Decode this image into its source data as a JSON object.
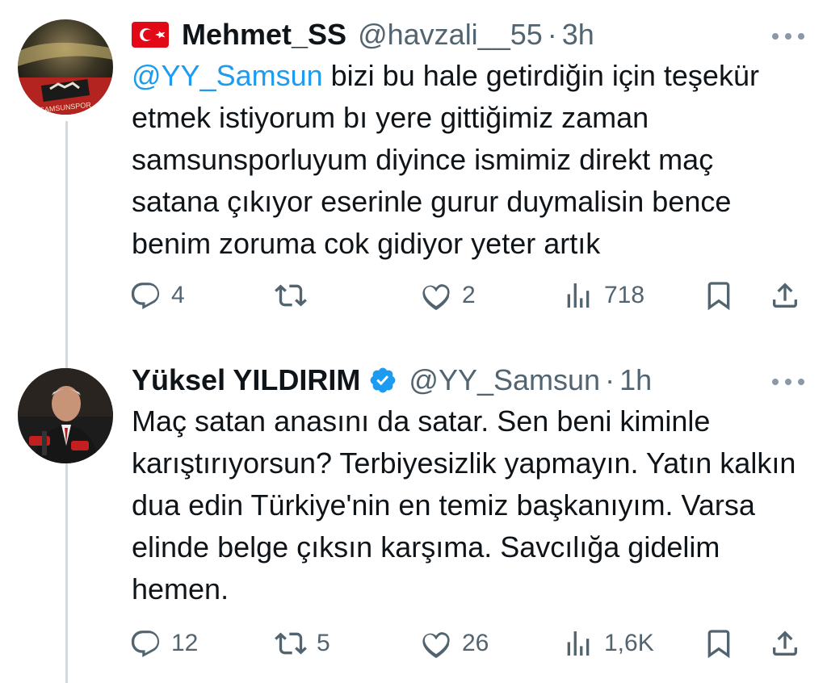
{
  "tweets": [
    {
      "author_name": "Mehmet_SS",
      "handle": "@havzali__55",
      "separator": "·",
      "time": "3h",
      "has_flag": true,
      "verified": false,
      "mention": "@YY_Samsun",
      "text": " bizi bu hale getirdiğin için teşekür etmek istiyorum bı yere gittiğimiz zaman samsunsporluyum diyince ismimiz direkt maç satana çıkıyor eserinle gurur duymalisin bence benim zoruma cok gidiyor yeter artık",
      "replies": "4",
      "retweets": "",
      "likes": "2",
      "views": "718"
    },
    {
      "author_name": "Yüksel YILDIRIM",
      "handle": "@YY_Samsun",
      "separator": "·",
      "time": "1h",
      "has_flag": false,
      "verified": true,
      "mention": "",
      "text": "Maç satan anasını da satar. Sen beni kiminle karıştırıyorsun? Terbiyesizlik yapmayın. Yatın kalkın dua edin Türkiye'nin en temiz başkanıyım. Varsa elinde belge çıksın karşıma. Savcılığa gidelim hemen.",
      "replies": "12",
      "retweets": "5",
      "likes": "26",
      "views": "1,6K"
    }
  ],
  "colors": {
    "text": "#0f1419",
    "secondary": "#536471",
    "mention": "#1d9bf0",
    "verified": "#1d9bf0",
    "thread_line": "#cfd9de"
  },
  "icons": [
    "turkey-flag-icon",
    "verified-badge-icon",
    "more-icon",
    "reply-icon",
    "retweet-icon",
    "like-icon",
    "views-icon",
    "bookmark-icon",
    "share-icon"
  ]
}
